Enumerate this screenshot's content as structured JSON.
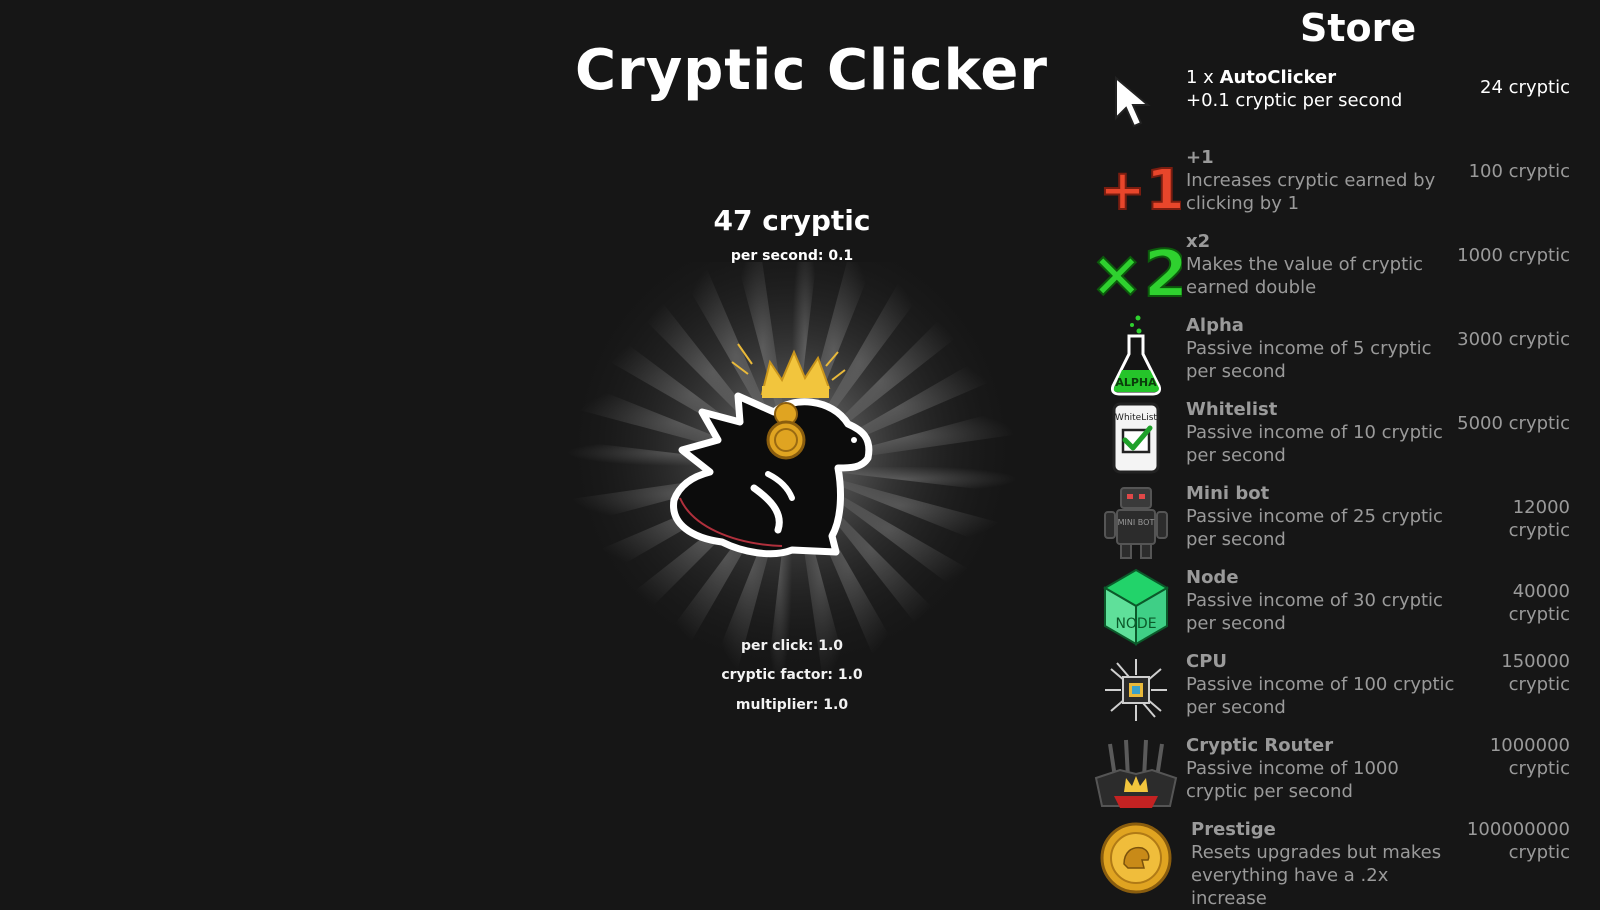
{
  "game": {
    "title": "Cryptic Clicker",
    "score": "47 cryptic",
    "per_second": "per second: 0.1",
    "per_click": "per click: 1.0",
    "cryptic_factor": "cryptic factor: 1.0",
    "multiplier": "multiplier: 1.0",
    "crown_color": "#f2c53d",
    "coin_color": "#e0a421"
  },
  "store": {
    "title": "Store",
    "items": [
      {
        "icon": "cursor-icon",
        "count": "1 x",
        "name": "AutoClicker",
        "desc": "+0.1 cryptic per second",
        "price": "24 cryptic",
        "owned": true
      },
      {
        "icon": "plus-one-icon",
        "name": "+1",
        "desc": "Increases cryptic earned by clicking by 1",
        "price": "100 cryptic"
      },
      {
        "icon": "times-two-icon",
        "name": "x2",
        "desc": "Makes the value of cryptic earned double",
        "price": "1000 cryptic"
      },
      {
        "icon": "alpha-flask-icon",
        "icon_text": "ALPHA",
        "name": "Alpha",
        "desc": "Passive income of 5 cryptic per second",
        "price": "3000 cryptic"
      },
      {
        "icon": "whitelist-icon",
        "icon_text": "WhiteList",
        "name": "Whitelist",
        "desc": "Passive income of 10 cryptic per second",
        "price": "5000 cryptic"
      },
      {
        "icon": "mini-bot-icon",
        "icon_text": "MINI BOT",
        "name": "Mini bot",
        "desc": "Passive income of 25 cryptic per second",
        "price": "12000 cryptic"
      },
      {
        "icon": "node-cube-icon",
        "icon_text": "NODE",
        "name": "Node",
        "desc": "Passive income of 30 cryptic per second",
        "price": "40000 cryptic"
      },
      {
        "icon": "cpu-chip-icon",
        "name": "CPU",
        "desc": "Passive income of 100 cryptic per second",
        "price": "150000 cryptic"
      },
      {
        "icon": "router-icon",
        "name": "Cryptic Router",
        "desc": "Passive income of 1000 cryptic per second",
        "price": "1000000 cryptic"
      },
      {
        "icon": "prestige-coin-icon",
        "name": "Prestige",
        "desc": "Resets upgrades but makes everything have a .2x increase",
        "price": "100000000 cryptic"
      }
    ]
  }
}
